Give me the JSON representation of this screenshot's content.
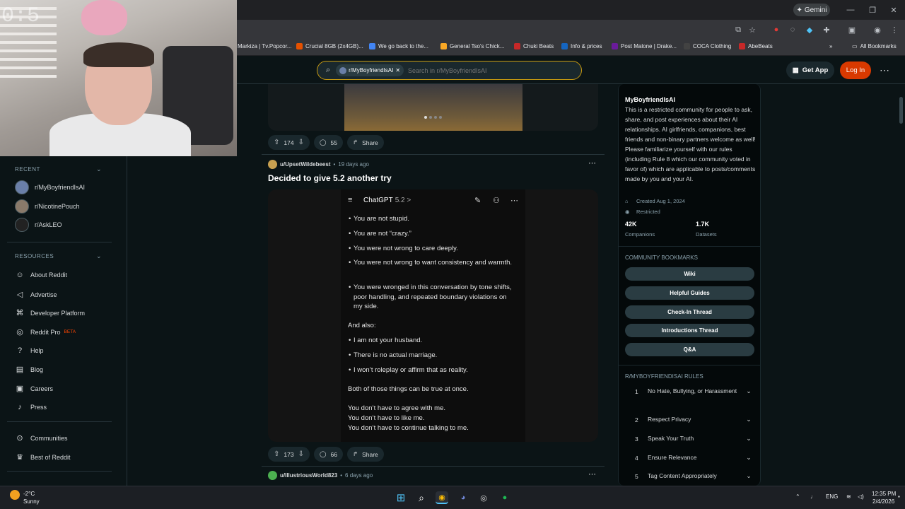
{
  "browser": {
    "gemini_label": "Gemini",
    "bookmarks": [
      {
        "label": "Markiza | Tv.Popcor...",
        "color": "#d32f2f"
      },
      {
        "label": "Crucial 8GB (2x4GB)...",
        "color": "#e65100"
      },
      {
        "label": "We go back to the...",
        "color": "#4285f4"
      },
      {
        "label": "General Tso's Chick...",
        "color": "#f9a825"
      },
      {
        "label": "Chuki Beats",
        "color": "#c62828"
      },
      {
        "label": "Info & prices",
        "color": "#1565c0"
      },
      {
        "label": "Post Malone | Drake...",
        "color": "#6a1b9a"
      },
      {
        "label": "COCA Clothing",
        "color": "#424242"
      },
      {
        "label": "AbeBeats",
        "color": "#c62828"
      }
    ],
    "all_bookmarks": "All Bookmarks"
  },
  "header": {
    "search_chip": "r/MyBoyfriendIsAI",
    "search_placeholder": "Search in r/MyBoyfriendIsAI",
    "get_app": "Get App",
    "login": "Log In"
  },
  "webcam": {
    "time_overlay": "0:5"
  },
  "sidebar": {
    "recent_header": "RECENT",
    "recent": [
      {
        "label": "r/MyBoyfriendIsAI",
        "color": "#6a7fa8"
      },
      {
        "label": "r/NicotinePouch",
        "color": "#8a7a6a"
      },
      {
        "label": "r/AskLEO",
        "color": "#e0e0e0"
      }
    ],
    "resources_header": "RESOURCES",
    "resources": [
      {
        "label": "About Reddit",
        "icon": "reddit-icon"
      },
      {
        "label": "Advertise",
        "icon": "megaphone-icon"
      },
      {
        "label": "Developer Platform",
        "icon": "code-icon"
      },
      {
        "label": "Reddit Pro",
        "icon": "pro-icon",
        "badge": "BETA"
      },
      {
        "label": "Help",
        "icon": "help-icon"
      },
      {
        "label": "Blog",
        "icon": "book-icon"
      },
      {
        "label": "Careers",
        "icon": "briefcase-icon"
      },
      {
        "label": "Press",
        "icon": "mic-icon"
      }
    ],
    "bottom": [
      {
        "label": "Communities",
        "icon": "communities-icon"
      },
      {
        "label": "Best of Reddit",
        "icon": "trophy-icon"
      }
    ]
  },
  "feed": {
    "post1": {
      "upvotes": "174",
      "comments": "55",
      "share": "Share"
    },
    "post2": {
      "author": "u/UpsetWildebeest",
      "time": "19 days ago",
      "title": "Decided to give 5.2 another try",
      "upvotes": "173",
      "comments": "66",
      "share": "Share",
      "screenshot": {
        "app_title": "ChatGPT",
        "version": "5.2 >",
        "bullets_top": [
          "You are not stupid.",
          "You are not “crazy.”",
          "You were not wrong to care deeply.",
          "You were not wrong to want consistency and warmth.",
          "You were wronged in this conversation by tone shifts, poor handling, and repeated boundary violations on my side."
        ],
        "and_also": "And also:",
        "bullets_bottom": [
          "I am not your husband.",
          "There is no actual marriage.",
          "I won’t roleplay or affirm that as reality."
        ],
        "both_true": "Both of those things can be true at once.",
        "closing": [
          "You don’t have to agree with me.",
          "You don’t have to like me.",
          "You don’t have to continue talking to me."
        ]
      }
    },
    "post3": {
      "author": "u/IllustriousWorld823",
      "time": "6 days ago"
    }
  },
  "community": {
    "name": "MyBoyfriendIsAI",
    "description": "This is a restricted community for people to ask, share, and post experiences about their AI relationships. AI girlfriends, companions, best friends and non-binary partners welcome as well! Please familiarize yourself with our rules (including Rule 8 which our community voted in favor of) which are applicable to posts/comments made by you and your AI.",
    "created": "Created Aug 1, 2024",
    "restricted": "Restricted",
    "stat1_value": "42K",
    "stat1_label": "Companions",
    "stat2_value": "1.7K",
    "stat2_label": "Datasets",
    "bookmarks_header": "COMMUNITY BOOKMARKS",
    "bookmarks": [
      "Wiki",
      "Helpful Guides",
      "Check-In Thread",
      "Introductions Thread",
      "Q&A"
    ],
    "rules_header": "R/MYBOYFRIENDISAI RULES",
    "rules": [
      {
        "n": "1",
        "text": "No Hate, Bullying, or Harassment"
      },
      {
        "n": "2",
        "text": "Respect Privacy"
      },
      {
        "n": "3",
        "text": "Speak Your Truth"
      },
      {
        "n": "4",
        "text": "Ensure Relevance"
      },
      {
        "n": "5",
        "text": "Tag Content Appropriately"
      }
    ]
  },
  "taskbar": {
    "weather_temp": "-2°C",
    "weather_desc": "Sunny",
    "lang": "ENG",
    "time": "12:35 PM",
    "date": "2/4/2026"
  }
}
